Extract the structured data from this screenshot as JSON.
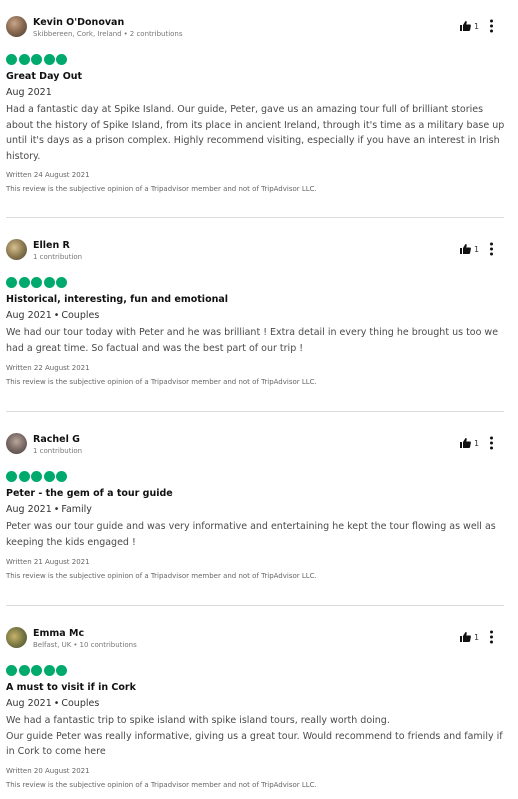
{
  "reviews": [
    {
      "author": "Kevin O'Donovan",
      "location": "Skibbereen, Cork, Ireland",
      "contributions": "2 contributions",
      "helpful_count": "1",
      "rating": 5,
      "title": "Great Day Out",
      "date": "Aug 2021",
      "trip_type": "",
      "body": "Had a fantastic day at Spike Island. Our guide, Peter, gave us an amazing tour full of brilliant stories about the history of Spike Island, from its place in ancient Ireland, through it's time as a military base up until it's days as a prison complex. Highly recommend visiting, especially if you have an interest in Irish history.",
      "written": "Written 24 August 2021",
      "disclaimer": "This review is the subjective opinion of a Tripadvisor member and not of TripAdvisor LLC."
    },
    {
      "author": "Ellen R",
      "location": "",
      "contributions": "1 contribution",
      "helpful_count": "1",
      "rating": 5,
      "title": "Historical, interesting, fun and emotional",
      "date": "Aug 2021",
      "trip_type": "Couples",
      "body": "We had our tour today with Peter and he was brilliant ! Extra detail in every thing he brought us too we had a great time. So factual and was the best part of our trip !",
      "written": "Written 22 August 2021",
      "disclaimer": "This review is the subjective opinion of a Tripadvisor member and not of TripAdvisor LLC."
    },
    {
      "author": "Rachel G",
      "location": "",
      "contributions": "1 contribution",
      "helpful_count": "1",
      "rating": 5,
      "title": "Peter - the gem of a tour guide",
      "date": "Aug 2021",
      "trip_type": "Family",
      "body": "Peter was our tour guide and was very informative and entertaining he kept the tour flowing as well as keeping the kids engaged !",
      "written": "Written 21 August 2021",
      "disclaimer": "This review is the subjective opinion of a Tripadvisor member and not of TripAdvisor LLC."
    },
    {
      "author": "Emma Mc",
      "location": "Belfast, UK",
      "contributions": "10 contributions",
      "helpful_count": "1",
      "rating": 5,
      "title": "A must to visit if in Cork",
      "date": "Aug 2021",
      "trip_type": "Couples",
      "body": "We had a fantastic trip to spike island with spike island tours, really worth doing.\nOur guide Peter was really informative, giving us a great tour. Would recommend to friends and family if in Cork to come here",
      "written": "Written 20 August 2021",
      "disclaimer": "This review is the subjective opinion of a Tripadvisor member and not of TripAdvisor LLC."
    }
  ],
  "colors": {
    "rating_bubble": "#00aa6c",
    "divider": "#dcdcdc"
  }
}
